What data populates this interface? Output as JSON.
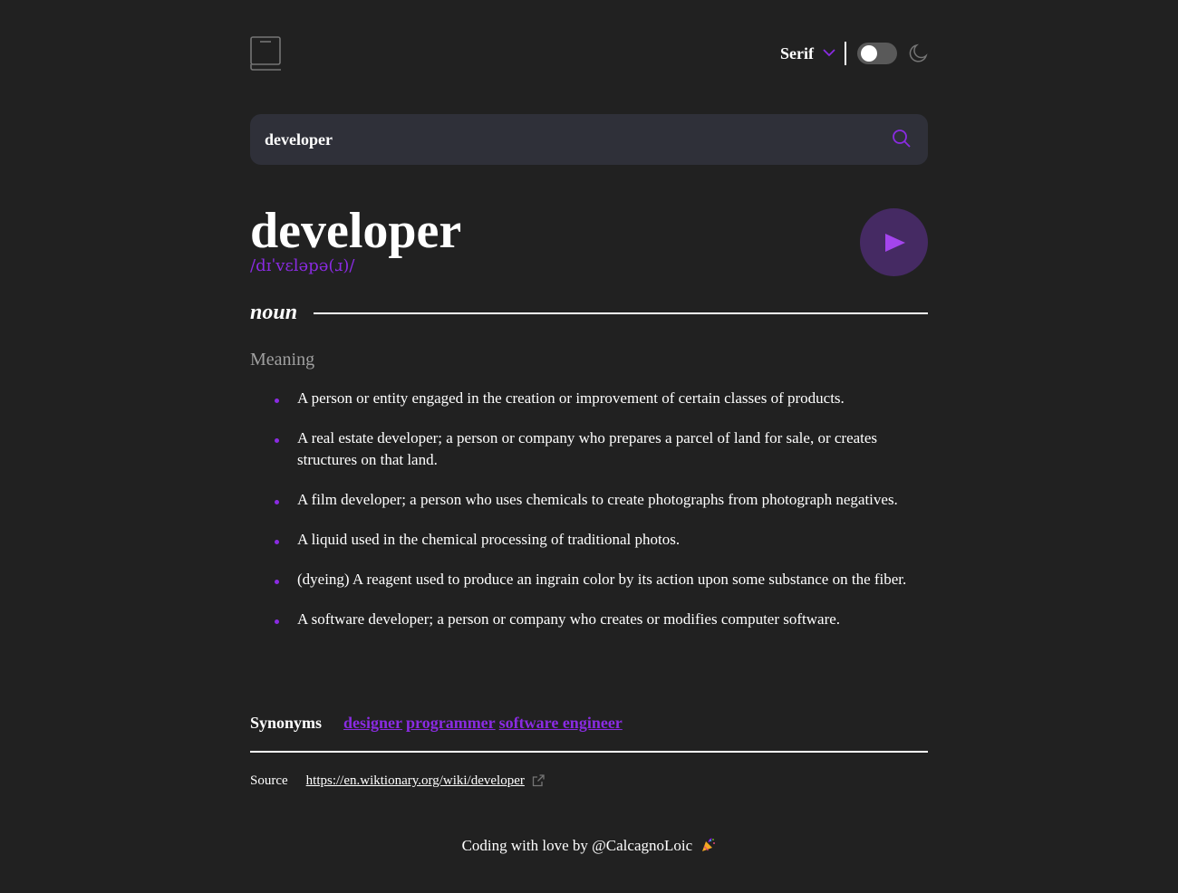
{
  "header": {
    "font_selected": "Serif",
    "theme_toggle_on": false
  },
  "search": {
    "value": "developer"
  },
  "entry": {
    "word": "developer",
    "phonetic": "/dɪˈvɛləpə(ɹ)/",
    "part_of_speech": "noun",
    "meaning_label": "Meaning",
    "definitions": [
      "A person or entity engaged in the creation or improvement of certain classes of products.",
      "A real estate developer; a person or company who prepares a parcel of land for sale, or creates structures on that land.",
      "A film developer; a person who uses chemicals to create photographs from photograph negatives.",
      "A liquid used in the chemical processing of traditional photos.",
      "(dyeing) A reagent used to produce an ingrain color by its action upon some substance on the fiber.",
      "A software developer; a person or company who creates or modifies computer software."
    ],
    "synonyms_label": "Synonyms",
    "synonyms": [
      "designer",
      "programmer",
      "software engineer"
    ]
  },
  "source": {
    "label": "Source",
    "url": "https://en.wiktionary.org/wiki/developer"
  },
  "footer": {
    "text": "Coding with love by @CalcagnoLoic"
  },
  "colors": {
    "background": "#212121",
    "accent": "#8a2be2",
    "search_bg": "#2f3039",
    "play_bg": "#452a63"
  },
  "icons": {
    "logo": "book-icon",
    "font_dropdown": "chevron-down-icon",
    "theme": "moon-icon",
    "search": "search-icon",
    "play": "play-icon",
    "external": "external-link-icon",
    "footer": "party-popper-icon"
  }
}
